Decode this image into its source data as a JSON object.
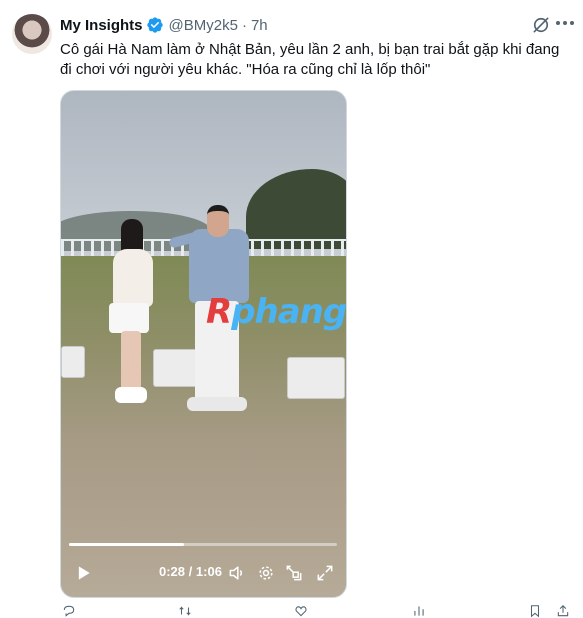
{
  "author": {
    "display_name": "My Insights",
    "handle": "@BMy2k5",
    "separator": "·",
    "time": "7h"
  },
  "tweet": {
    "text": "Cô gái Hà Nam làm ở Nhật Bản, yêu lần 2 anh, bị bạn trai bắt gặp khi đang đi chơi với người yêu khác. \"Hóa ra cũng chỉ là lốp thôi\""
  },
  "media": {
    "watermark_red": "R",
    "watermark_blue": "phang",
    "video": {
      "current_time": "0:28",
      "time_separator": "/",
      "duration": "1:06",
      "progress_fraction": 0.43
    }
  },
  "icons": {
    "verified": "verified-badge-icon",
    "grok": "grok-icon",
    "more": "more-icon",
    "play": "play-icon",
    "volume": "volume-icon",
    "settings": "gear-icon",
    "pip": "picture-in-picture-icon",
    "fullscreen": "fullscreen-icon",
    "reply": "reply-icon",
    "repost": "repost-icon",
    "like": "like-icon",
    "views": "views-icon",
    "bookmark": "bookmark-icon",
    "share": "share-icon"
  },
  "colors": {
    "verified_blue": "#1d9bf0",
    "secondary_text": "#536471",
    "primary_text": "#0f1419"
  }
}
